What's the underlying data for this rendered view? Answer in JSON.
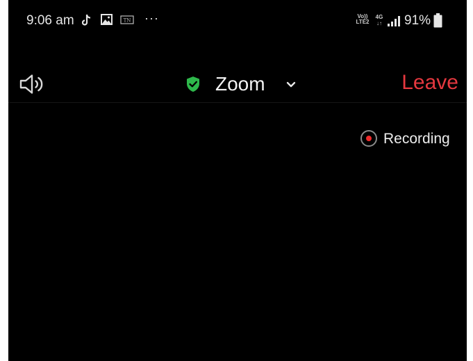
{
  "status_bar": {
    "time": "9:06 am",
    "notification_icons": [
      "tiktok-icon",
      "image-icon",
      "tn-icon"
    ],
    "more": "···",
    "volte_top": "Vo))",
    "volte_bottom": "LTE2",
    "network_type": "4G",
    "network_arrows": "↓↑",
    "battery_percent": "91%"
  },
  "meeting_header": {
    "speaker_icon": "speaker-icon",
    "encryption_icon": "shield-check-icon",
    "title": "Zoom",
    "title_dropdown_icon": "chevron-down-icon",
    "leave_label": "Leave"
  },
  "recording": {
    "label": "Recording",
    "dot_color": "#ef2b2b"
  },
  "colors": {
    "background": "#000000",
    "leave": "#e5383f",
    "shield": "#2eb84b",
    "text": "#f2f2f2"
  }
}
